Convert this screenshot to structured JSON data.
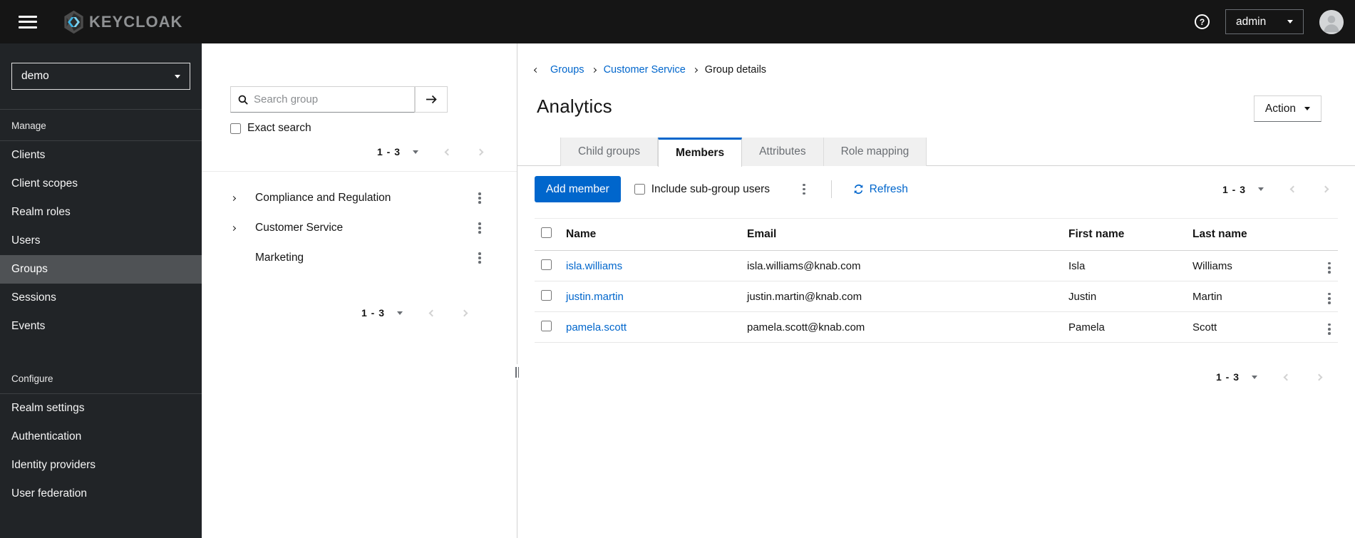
{
  "topbar": {
    "brand": "KEYCLOAK",
    "username": "admin"
  },
  "sidebar": {
    "realm": "demo",
    "active_item": "Groups",
    "sections": [
      {
        "label": "Manage",
        "items": [
          {
            "label": "Clients"
          },
          {
            "label": "Client scopes"
          },
          {
            "label": "Realm roles"
          },
          {
            "label": "Users"
          },
          {
            "label": "Groups"
          },
          {
            "label": "Sessions"
          },
          {
            "label": "Events"
          }
        ]
      },
      {
        "label": "Configure",
        "items": [
          {
            "label": "Realm settings"
          },
          {
            "label": "Authentication"
          },
          {
            "label": "Identity providers"
          },
          {
            "label": "User federation"
          }
        ]
      }
    ]
  },
  "group_panel": {
    "search_placeholder": "Search group",
    "exact_search_label": "Exact search",
    "pagination_top": {
      "range": "1 - 3"
    },
    "pagination_bottom": {
      "range": "1 - 3"
    },
    "tree": [
      {
        "label": "Compliance and Regulation",
        "expandable": true
      },
      {
        "label": "Customer Service",
        "expandable": true
      },
      {
        "label": "Marketing",
        "expandable": false
      }
    ]
  },
  "main": {
    "breadcrumb": {
      "items": [
        {
          "label": "Groups"
        },
        {
          "label": "Customer Service"
        },
        {
          "label": "Group details"
        }
      ]
    },
    "title": "Analytics",
    "action_button_label": "Action",
    "tabs": [
      {
        "label": "Child groups",
        "active": false
      },
      {
        "label": "Members",
        "active": true
      },
      {
        "label": "Attributes",
        "active": false
      },
      {
        "label": "Role mapping",
        "active": false
      }
    ],
    "toolbar": {
      "add_member_label": "Add member",
      "include_subgroups_label": "Include sub-group users",
      "refresh_label": "Refresh",
      "pagination": {
        "range": "1 - 3"
      }
    },
    "table": {
      "columns": [
        "Name",
        "Email",
        "First name",
        "Last name"
      ],
      "rows": [
        {
          "name": "isla.williams",
          "email": "isla.williams@knab.com",
          "first": "Isla",
          "last": "Williams"
        },
        {
          "name": "justin.martin",
          "email": "justin.martin@knab.com",
          "first": "Justin",
          "last": "Martin"
        },
        {
          "name": "pamela.scott",
          "email": "pamela.scott@knab.com",
          "first": "Pamela",
          "last": "Scott"
        }
      ]
    },
    "pagination_bottom": {
      "range": "1 - 3"
    }
  },
  "colors": {
    "primary": "#0066cc",
    "link": "#0066cc",
    "topbar_bg": "#151515",
    "sidebar_bg": "#212427",
    "sidebar_active_bg": "#4f5255",
    "tab_inactive_bg": "#f0f0f0",
    "border": "#d2d2d2",
    "text": "#151515",
    "muted": "#6a6e73"
  }
}
